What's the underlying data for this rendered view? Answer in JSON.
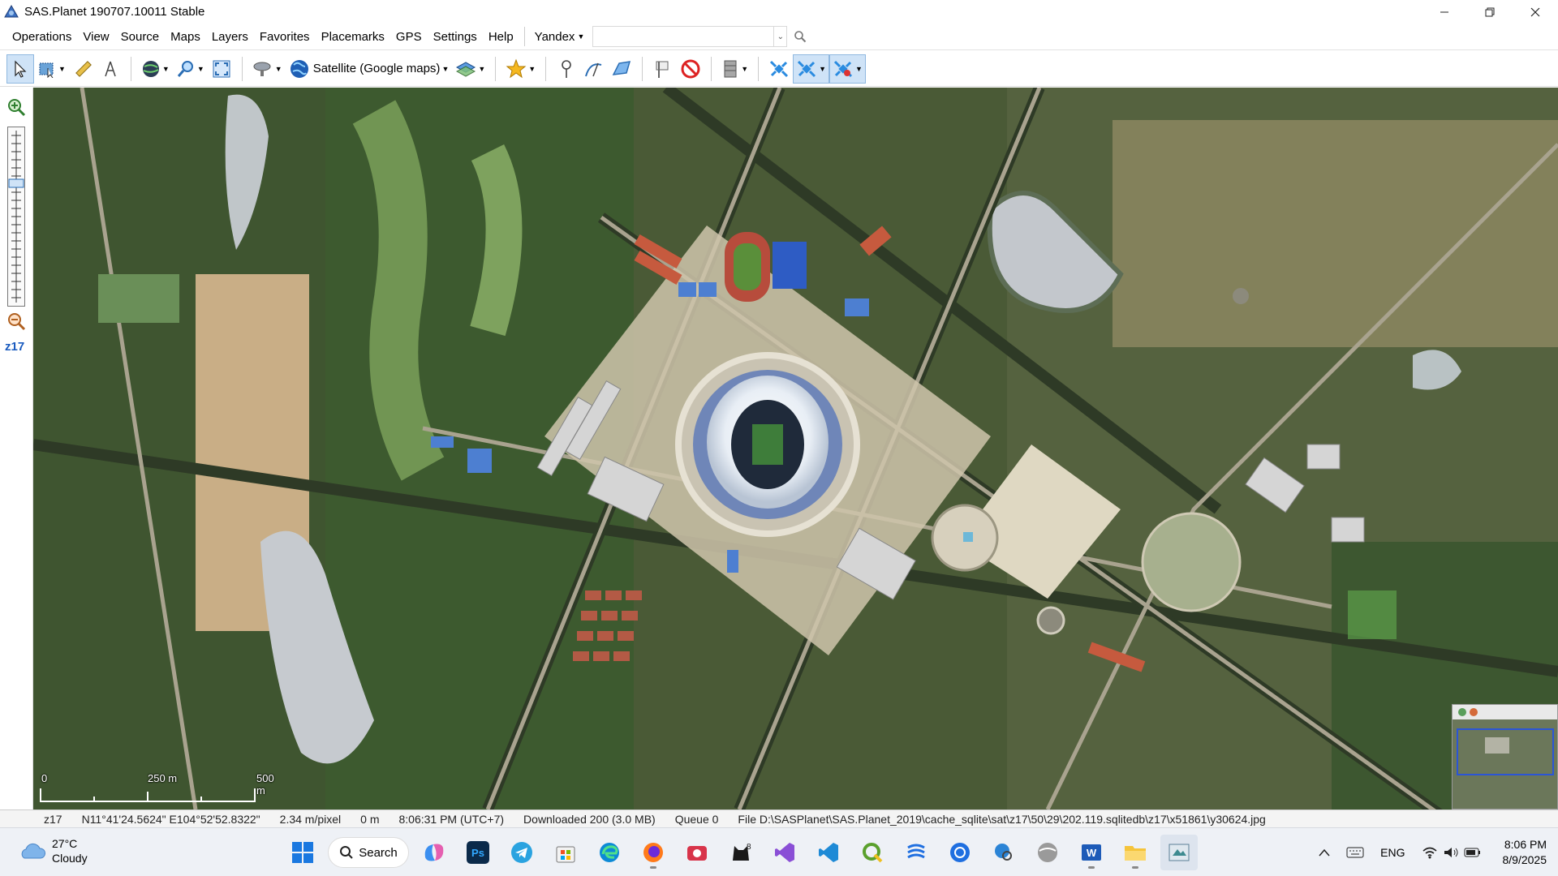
{
  "window": {
    "title": "SAS.Planet 190707.10011 Stable"
  },
  "menu": {
    "items": [
      "Operations",
      "View",
      "Source",
      "Maps",
      "Layers",
      "Favorites",
      "Placemarks",
      "GPS",
      "Settings",
      "Help"
    ],
    "search_provider": "Yandex",
    "search_value": ""
  },
  "toolbar": {
    "map_source_label": "Satellite (Google maps)"
  },
  "zoom": {
    "level": "z17"
  },
  "scale": {
    "zero": "0",
    "mid": "250 m",
    "end": "500 m"
  },
  "status": {
    "zoom": "z17",
    "coords": "N11°41'24.5624\" E104°52'52.8322\"",
    "resolution": "2.34 m/pixel",
    "distance": "0 m",
    "time": "8:06:31 PM (UTC+7)",
    "downloaded": "Downloaded 200 (3.0 MB)",
    "queue": "Queue 0",
    "file": "File D:\\SASPlanet\\SAS.Planet_2019\\cache_sqlite\\sat\\z17\\50\\29\\202.119.sqlitedb\\z17\\x51861\\y30624.jpg"
  },
  "taskbar": {
    "weather_temp": "27°C",
    "weather_desc": "Cloudy",
    "search_label": "Search",
    "language": "ENG",
    "time": "8:06 PM",
    "date": "8/9/2025",
    "ps_label": "Ps",
    "badge": "8"
  }
}
